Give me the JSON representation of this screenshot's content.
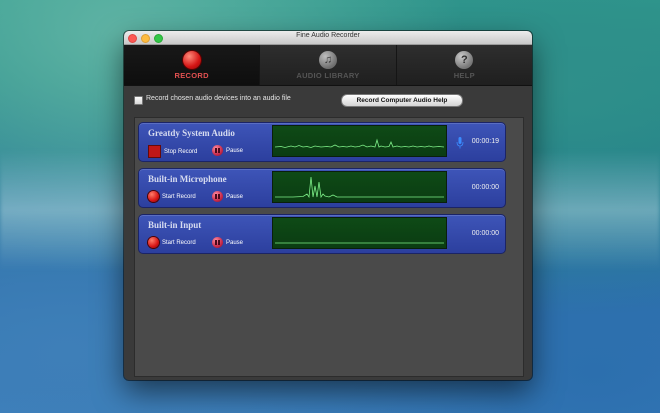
{
  "window": {
    "title": "Fine Audio Recorder"
  },
  "tabs": [
    {
      "label": "RECORD",
      "icon": "record-icon",
      "active": true
    },
    {
      "label": "AUDIO LIBRARY",
      "icon": "music-note-icon",
      "active": false
    },
    {
      "label": "HELP",
      "icon": "question-icon",
      "active": false
    }
  ],
  "options": {
    "record_to_file_label": "Record chosen audio devices into an audio file",
    "record_to_file_checked": false,
    "help_button_label": "Record Computer Audio Help"
  },
  "devices": [
    {
      "name": "Greatdy System Audio",
      "record_label": "Stop Record",
      "pause_label": "Pause",
      "recording": true,
      "timer": "00:00:19",
      "mic_icon": "microphone-icon"
    },
    {
      "name": "Built-in Microphone",
      "record_label": "Start Record",
      "pause_label": "Pause",
      "recording": false,
      "timer": "00:00:00"
    },
    {
      "name": "Built-in Input",
      "record_label": "Start Record",
      "pause_label": "Pause",
      "recording": false,
      "timer": "00:00:00"
    }
  ],
  "colors": {
    "accent_red": "#e05050",
    "device_row_blue": "#3e55b8",
    "waveform_green": "#0e4a16",
    "waveform_line": "#4fe05a"
  }
}
